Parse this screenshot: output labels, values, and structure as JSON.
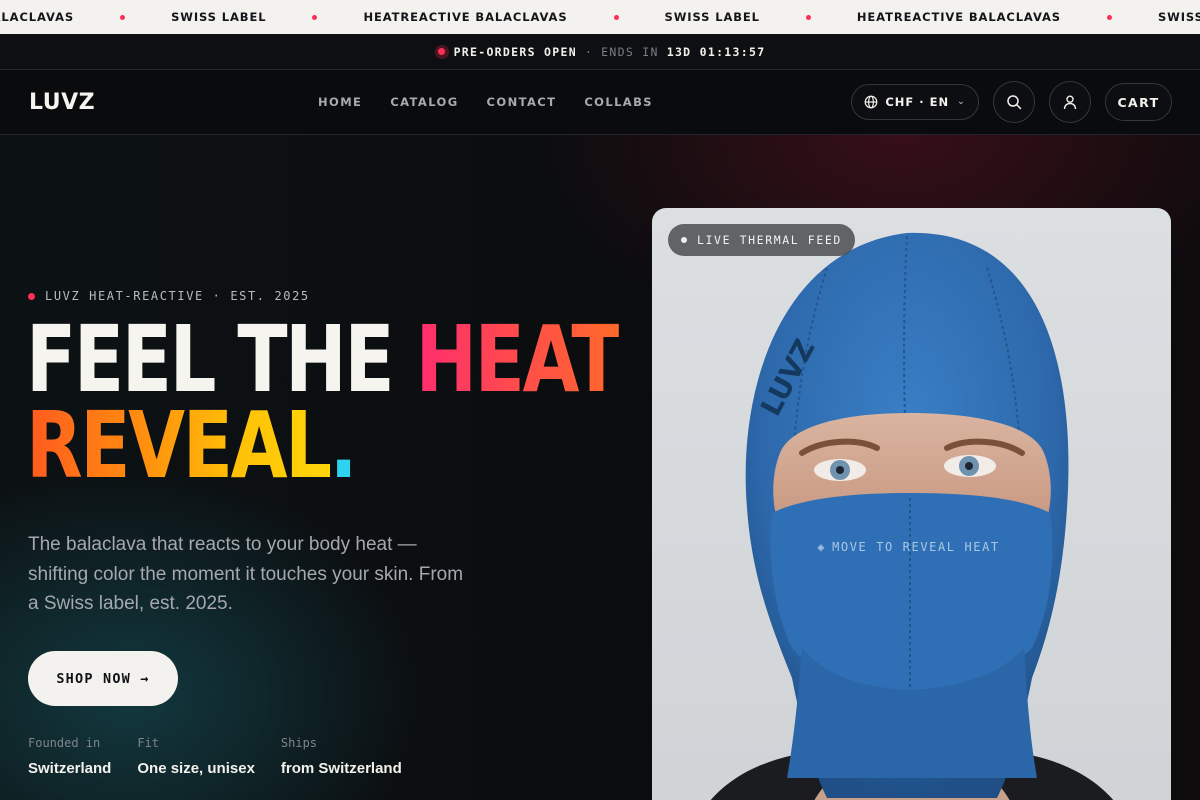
{
  "ticker": {
    "items": [
      "HEATREACTIVE BALACLAVAS",
      "SWISS LABEL",
      "HEATREACTIVE BALACLAVAS",
      "SWISS LABEL",
      "HEATREACTIVE BALACLAVAS",
      "SWISS LABEL"
    ]
  },
  "announcement": {
    "status": "PRE-ORDERS OPEN",
    "separator": "·",
    "ends_label": "ENDS IN",
    "countdown": "13D 01:13:57"
  },
  "header": {
    "logo": "LUVZ",
    "nav": [
      {
        "label": "HOME"
      },
      {
        "label": "CATALOG"
      },
      {
        "label": "CONTACT"
      },
      {
        "label": "COLLABS"
      }
    ],
    "currency": "CHF · EN",
    "cart": "CART"
  },
  "hero": {
    "eyebrow": "LUVZ HEAT-REACTIVE · EST. 2025",
    "headline": {
      "part1": "FEEL THE ",
      "part2": "HEAT",
      "part3": "REVEAL",
      "part4": "."
    },
    "description": "The balaclava that reacts to your body heat — shifting color the moment it touches your skin. From a Swiss label, est. 2025.",
    "cta": "SHOP NOW →",
    "facts": [
      {
        "label": "Founded in",
        "value": "Switzerland"
      },
      {
        "label": "Fit",
        "value": "One size, unisex"
      },
      {
        "label": "Ships",
        "value": "from Switzerland"
      }
    ],
    "image": {
      "badge": "LIVE THERMAL FEED",
      "hint_icon": "◈",
      "hint": "MOVE TO REVEAL HEAT",
      "print": "LUVZ"
    }
  },
  "colors": {
    "accent_pink": "#ff2d55",
    "heat_gradient": "#ff2d6e",
    "reveal_gradient_start": "#ff5a1f",
    "reveal_gradient_end": "#ffd60a",
    "dot_cyan": "#2fd3f0",
    "balaclava_blue": "#2f6fb5"
  },
  "icons": {
    "globe": "globe-icon",
    "search": "search-icon",
    "account": "user-icon",
    "chevron": "chevron-down-icon"
  }
}
